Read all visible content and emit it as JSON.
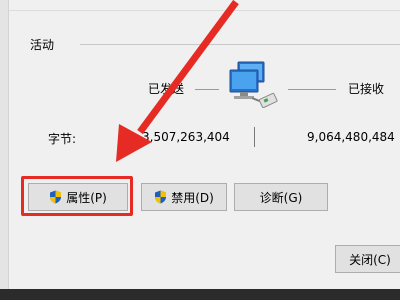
{
  "activity": {
    "title": "活动",
    "sent_label": "已发送",
    "received_label": "已接收"
  },
  "bytes": {
    "label": "字节:",
    "sent": "3,507,263,404",
    "received": "9,064,480,484"
  },
  "buttons": {
    "properties": "属性(P)",
    "disable": "禁用(D)",
    "diagnose": "诊断(G)",
    "close": "关闭(C)"
  },
  "colors": {
    "annotation_red": "#e52b24",
    "shield_blue": "#1f5fbf",
    "shield_yellow": "#f2c200"
  },
  "icons": {
    "network": "network-computers-icon",
    "shield": "uac-shield-icon"
  }
}
